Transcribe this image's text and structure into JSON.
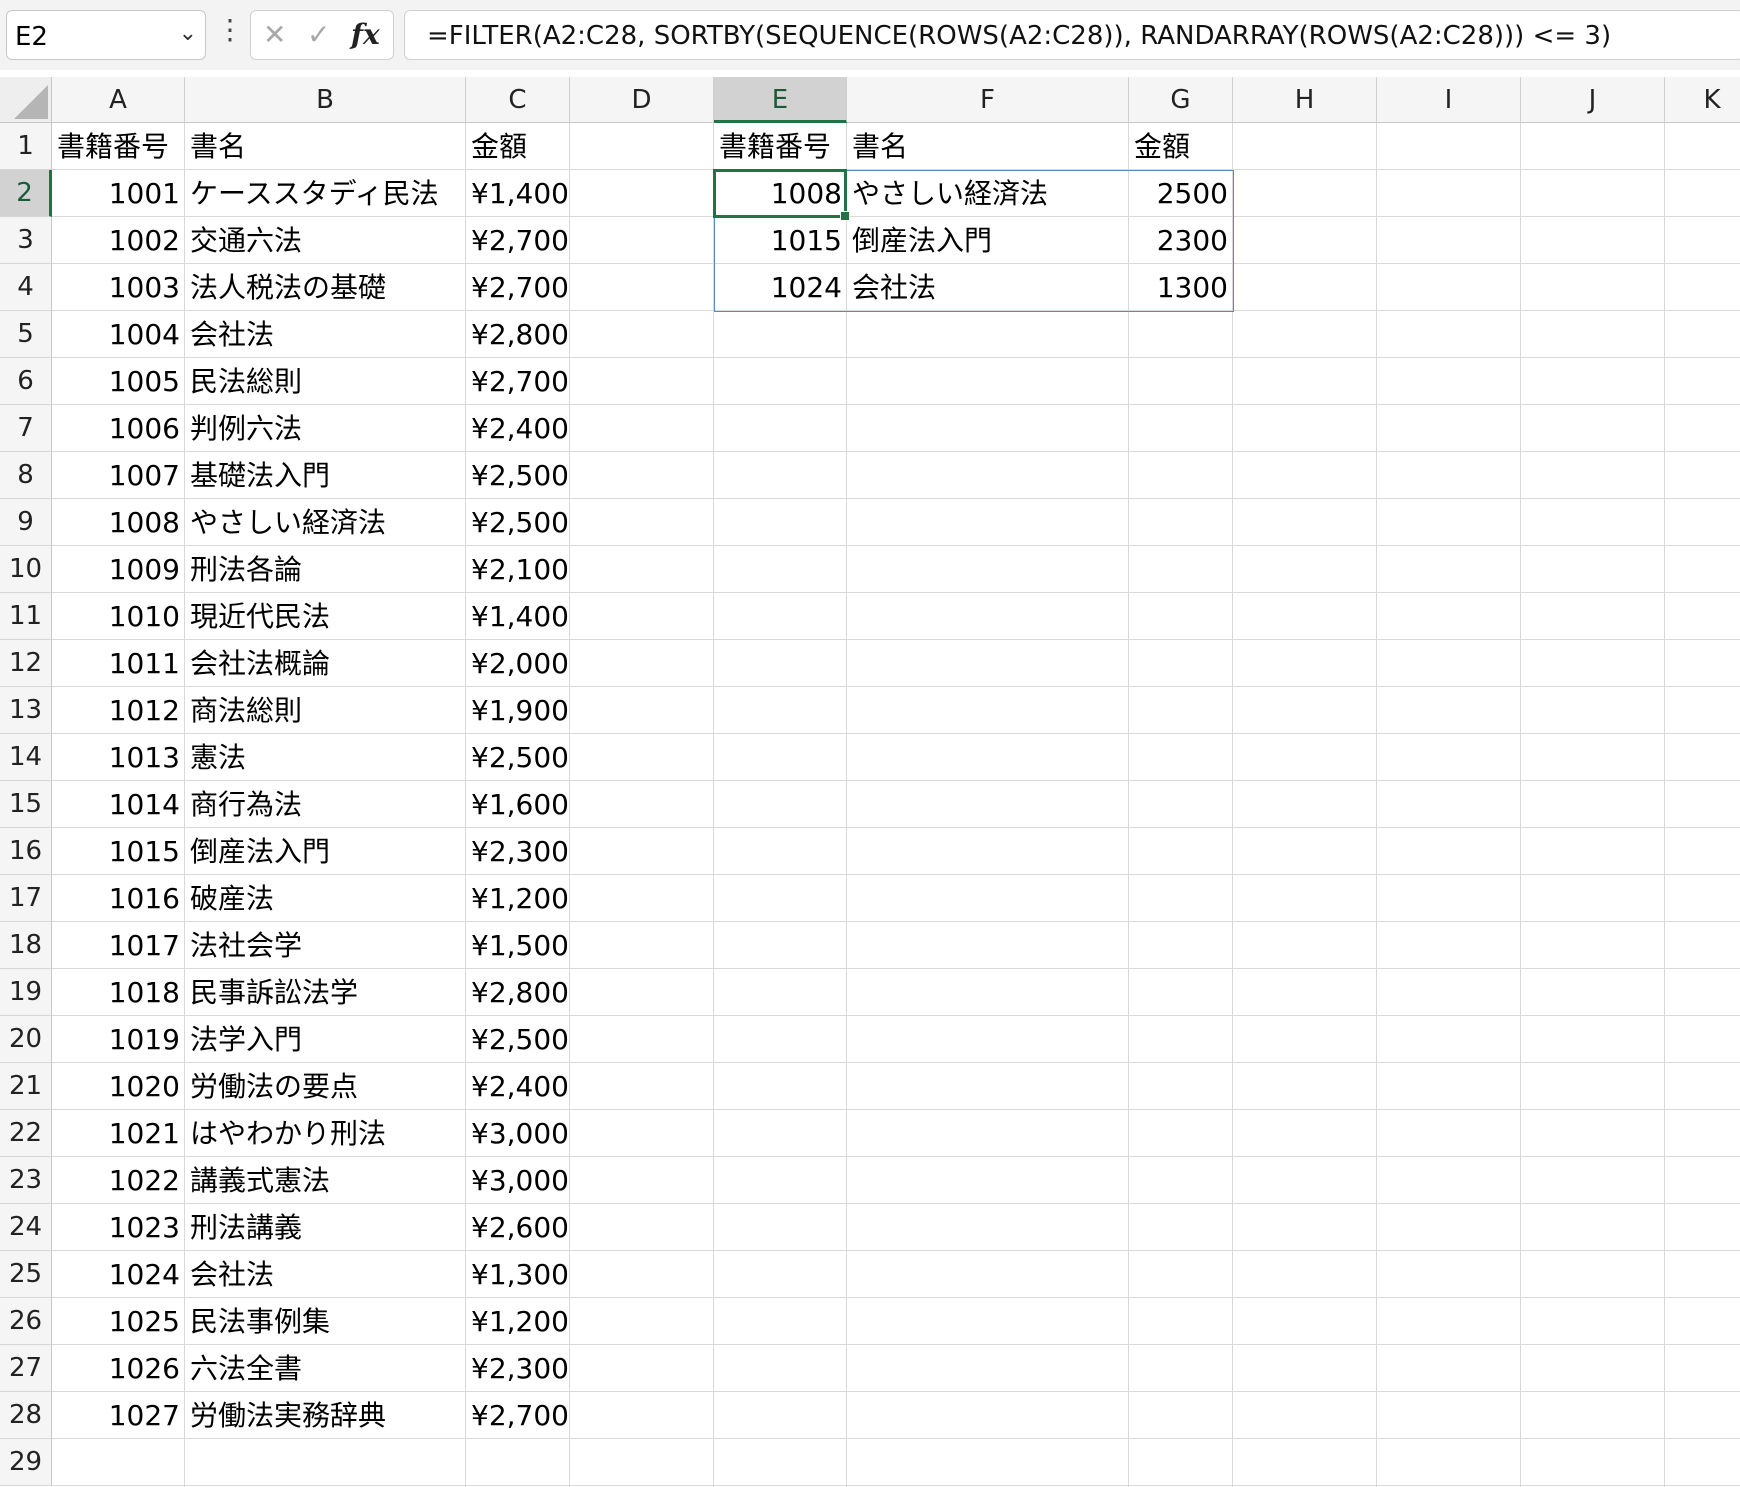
{
  "formula_bar": {
    "name_box": "E2",
    "formula": "=FILTER(A2:C28, SORTBY(SEQUENCE(ROWS(A2:C28)), RANDARRAY(ROWS(A2:C28))) <= 3)"
  },
  "sheet": {
    "columns": [
      "A",
      "B",
      "C",
      "D",
      "E",
      "F",
      "G",
      "H",
      "I",
      "J",
      "K"
    ],
    "selected_column": "E",
    "selected_row": 2,
    "row_numbers": [
      1,
      2,
      3,
      4,
      5,
      6,
      7,
      8,
      9,
      10,
      11,
      12,
      13,
      14,
      15,
      16,
      17,
      18,
      19,
      20,
      21,
      22,
      23,
      24,
      25,
      26,
      27,
      28,
      29
    ],
    "source_headers": [
      "書籍番号",
      "書名",
      "金額"
    ],
    "source_rows": [
      [
        "1001",
        "ケーススタディ民法",
        "¥1,400"
      ],
      [
        "1002",
        "交通六法",
        "¥2,700"
      ],
      [
        "1003",
        "法人税法の基礎",
        "¥2,700"
      ],
      [
        "1004",
        "会社法",
        "¥2,800"
      ],
      [
        "1005",
        "民法総則",
        "¥2,700"
      ],
      [
        "1006",
        "判例六法",
        "¥2,400"
      ],
      [
        "1007",
        "基礎法入門",
        "¥2,500"
      ],
      [
        "1008",
        "やさしい経済法",
        "¥2,500"
      ],
      [
        "1009",
        "刑法各論",
        "¥2,100"
      ],
      [
        "1010",
        "現近代民法",
        "¥1,400"
      ],
      [
        "1011",
        "会社法概論",
        "¥2,000"
      ],
      [
        "1012",
        "商法総則",
        "¥1,900"
      ],
      [
        "1013",
        "憲法",
        "¥2,500"
      ],
      [
        "1014",
        "商行為法",
        "¥1,600"
      ],
      [
        "1015",
        "倒産法入門",
        "¥2,300"
      ],
      [
        "1016",
        "破産法",
        "¥1,200"
      ],
      [
        "1017",
        "法社会学",
        "¥1,500"
      ],
      [
        "1018",
        "民事訴訟法学",
        "¥2,800"
      ],
      [
        "1019",
        "法学入門",
        "¥2,500"
      ],
      [
        "1020",
        "労働法の要点",
        "¥2,400"
      ],
      [
        "1021",
        "はやわかり刑法",
        "¥3,000"
      ],
      [
        "1022",
        "講義式憲法",
        "¥3,000"
      ],
      [
        "1023",
        "刑法講義",
        "¥2,600"
      ],
      [
        "1024",
        "会社法",
        "¥1,300"
      ],
      [
        "1025",
        "民法事例集",
        "¥1,200"
      ],
      [
        "1026",
        "六法全書",
        "¥2,300"
      ],
      [
        "1027",
        "労働法実務辞典",
        "¥2,700"
      ]
    ],
    "result_headers": [
      "書籍番号",
      "書名",
      "金額"
    ],
    "result_rows": [
      [
        "1008",
        "やさしい経済法",
        "2500"
      ],
      [
        "1015",
        "倒産法入門",
        "2300"
      ],
      [
        "1024",
        "会社法",
        "1300"
      ]
    ]
  }
}
